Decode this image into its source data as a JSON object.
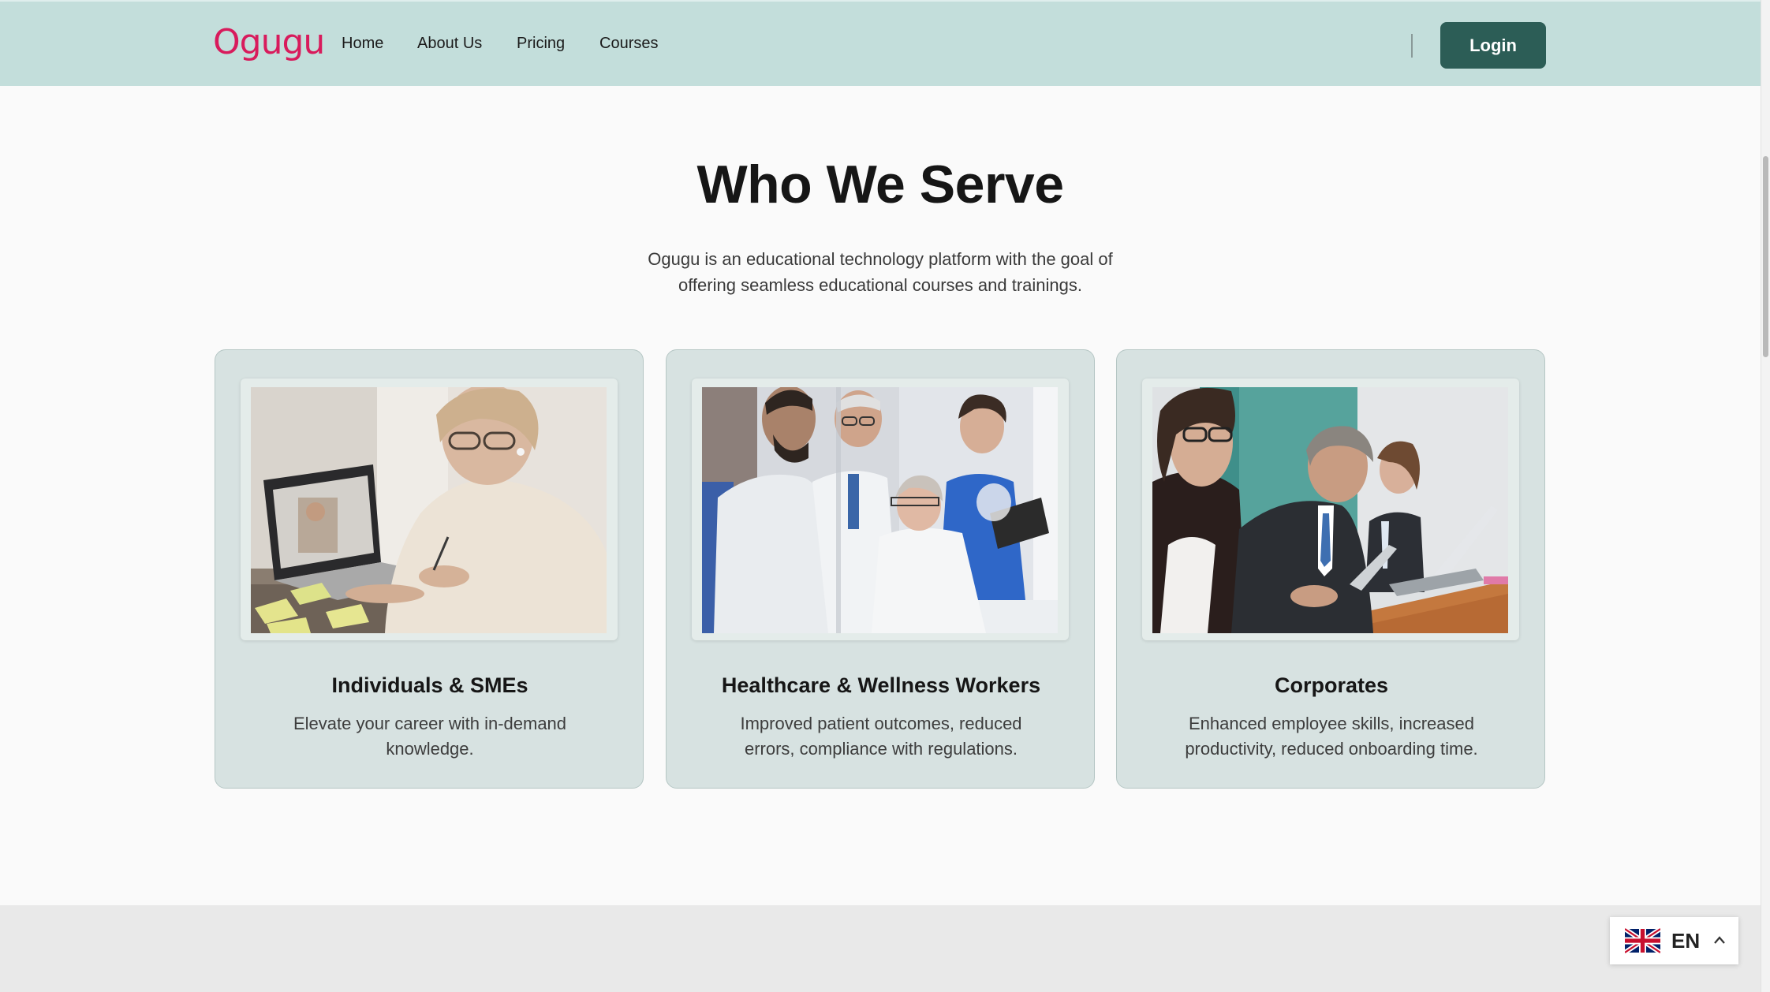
{
  "brand": {
    "logo_text": "Ogugu",
    "logo_color": "#d81b5c"
  },
  "nav": {
    "links": [
      {
        "label": "Home"
      },
      {
        "label": "About Us"
      },
      {
        "label": "Pricing"
      },
      {
        "label": "Courses"
      }
    ],
    "login_label": "Login",
    "bar_color": "#c3dedb",
    "button_color": "#2c5d56"
  },
  "section": {
    "title": "Who We Serve",
    "description": "Ogugu is an educational technology platform with the goal of offering seamless educational courses and trainings."
  },
  "cards": [
    {
      "title": "Individuals & SMEs",
      "description": "Elevate your career with in-demand knowledge.",
      "image": "woman-studying-laptop-photo"
    },
    {
      "title": "Healthcare & Wellness Workers",
      "description": "Improved patient outcomes, reduced errors, compliance with regulations.",
      "image": "medical-team-photo"
    },
    {
      "title": "Corporates",
      "description": "Enhanced employee skills, increased productivity, reduced onboarding time.",
      "image": "business-people-laptops-photo"
    }
  ],
  "language": {
    "code": "EN",
    "flag": "uk-flag-icon"
  }
}
